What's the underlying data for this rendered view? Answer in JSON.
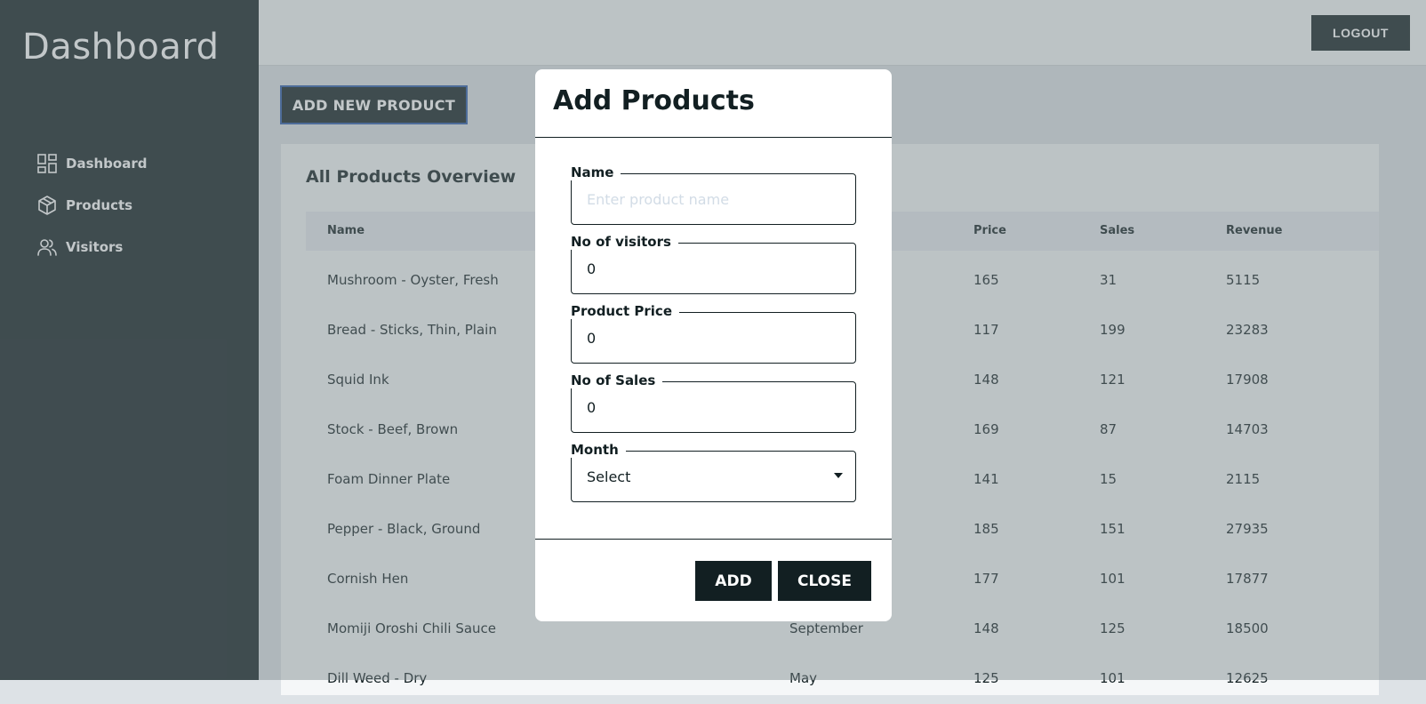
{
  "sidebar": {
    "brand": "Dashboard",
    "items": [
      {
        "label": "Dashboard",
        "icon": "dashboard-grid-icon"
      },
      {
        "label": "Products",
        "icon": "box-icon"
      },
      {
        "label": "Visitors",
        "icon": "users-icon"
      }
    ]
  },
  "topbar": {
    "logout_label": "LOGOUT"
  },
  "main": {
    "add_button_label": "ADD NEW PRODUCT",
    "card_title": "All Products Overview",
    "columns": [
      "Name",
      "Price",
      "Sales",
      "Revenue"
    ],
    "rows": [
      {
        "name": "Mushroom - Oyster, Fresh",
        "month": "",
        "price": "165",
        "sales": "31",
        "revenue": "5115"
      },
      {
        "name": "Bread - Sticks, Thin, Plain",
        "month": "",
        "price": "117",
        "sales": "199",
        "revenue": "23283"
      },
      {
        "name": "Squid Ink",
        "month": "",
        "price": "148",
        "sales": "121",
        "revenue": "17908"
      },
      {
        "name": "Stock - Beef, Brown",
        "month": "",
        "price": "169",
        "sales": "87",
        "revenue": "14703"
      },
      {
        "name": "Foam Dinner Plate",
        "month": "",
        "price": "141",
        "sales": "15",
        "revenue": "2115"
      },
      {
        "name": "Pepper - Black, Ground",
        "month": "",
        "price": "185",
        "sales": "151",
        "revenue": "27935"
      },
      {
        "name": "Cornish Hen",
        "month": "",
        "price": "177",
        "sales": "101",
        "revenue": "17877"
      },
      {
        "name": "Momiji Oroshi Chili Sauce",
        "month": "September",
        "price": "148",
        "sales": "125",
        "revenue": "18500"
      },
      {
        "name": "Dill Weed - Dry",
        "month": "May",
        "price": "125",
        "sales": "101",
        "revenue": "12625"
      }
    ]
  },
  "modal": {
    "title": "Add Products",
    "fields": {
      "name": {
        "label": "Name",
        "placeholder": "Enter product name"
      },
      "visitors": {
        "label": "No of visitors",
        "value": "0"
      },
      "price": {
        "label": "Product Price",
        "value": "0"
      },
      "sales": {
        "label": "No of Sales",
        "value": "0"
      },
      "month": {
        "label": "Month",
        "value": "Select"
      }
    },
    "add_label": "ADD",
    "close_label": "CLOSE"
  },
  "colors": {
    "sidebar_bg": "#121f22",
    "accent": "#121f22",
    "button_border": "#2a5aa8"
  }
}
